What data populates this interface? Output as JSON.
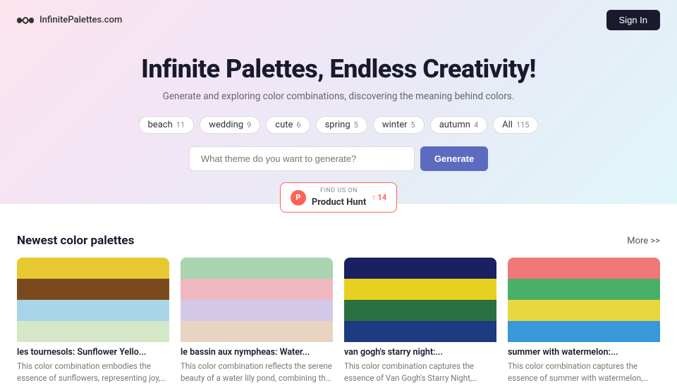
{
  "brand": {
    "name": "InfinitePalettes.com"
  },
  "header": {
    "sign_in_label": "Sign In"
  },
  "hero": {
    "title": "Infinite Palettes, Endless Creativity!",
    "subtitle": "Generate and exploring color combinations, discovering the meaning behind colors.",
    "search_placeholder": "What theme do you want to generate?",
    "generate_label": "Generate"
  },
  "tags": [
    {
      "label": "beach",
      "count": "11"
    },
    {
      "label": "wedding",
      "count": "9"
    },
    {
      "label": "cute",
      "count": "6"
    },
    {
      "label": "spring",
      "count": "5"
    },
    {
      "label": "winter",
      "count": "5"
    },
    {
      "label": "autumn",
      "count": "4"
    },
    {
      "label": "All",
      "count": "115"
    }
  ],
  "product_hunt": {
    "logo_text": "P",
    "find_us": "FIND US ON",
    "product_label": "Product Hunt",
    "upvote": "↑ 14"
  },
  "newest_palettes": {
    "section_title": "Newest color palettes",
    "more_label": "More >>",
    "palettes": [
      {
        "name": "les tournesols: Sunflower Yello...",
        "description": "This color combination embodies the essence of sunflowers, representing joy, stability, and a connection to nature. Th...",
        "colors": [
          "#e8c830",
          "#7a4a1e",
          "#a8d4e8",
          "#d4e8c8"
        ]
      },
      {
        "name": "le bassin aux nympheas: Water...",
        "description": "This color combination reflects the serene beauty of a water lily pond, combining the tranquility of nature with...",
        "colors": [
          "#a8d4b0",
          "#f0b8c0",
          "#d4c8e8",
          "#e8d4c0"
        ]
      },
      {
        "name": "van gogh's starry night:...",
        "description": "This color combination captures the essence of Van Gogh's Starry Night, blending the calmness of the night sky...",
        "colors": [
          "#1a2060",
          "#e8d020",
          "#2a7040",
          "#1e3a80"
        ]
      },
      {
        "name": "summer with watermelon:...",
        "description": "This color combination captures the essence of summer with watermelon, blending vibrant and refreshing hues th...",
        "colors": [
          "#f07878",
          "#4ab068",
          "#e8d840",
          "#3898d8"
        ]
      }
    ]
  }
}
